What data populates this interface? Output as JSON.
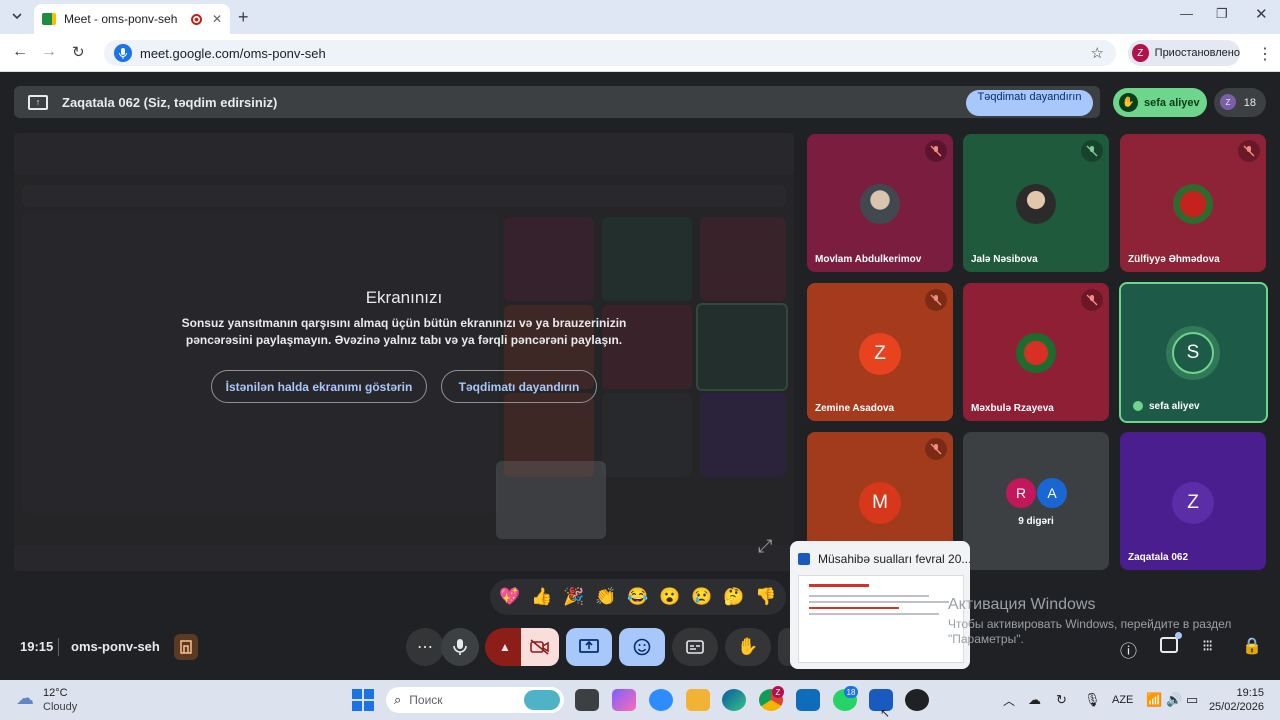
{
  "browser": {
    "tab_title": "Meet - oms-ponv-seh",
    "url": "meet.google.com/oms-ponv-seh",
    "profile_initial": "Z",
    "profile_status": "Приостановлено"
  },
  "presentation": {
    "banner": "Zaqatala 062 (Siz, təqdim edirsiniz)",
    "stop_button": "Təqdimatı dayandırın",
    "active_speaker": "sefa aliyev",
    "participant_count": "18"
  },
  "share_overlay": {
    "title": "Ekranınızı",
    "line1": "Sonsuz yansıtmanın qarşısını almaq üçün bütün ekranınızı və ya brauzerinizin",
    "line2": "pəncərəsini paylaşmayın. Əvəzinə yalnız tabı və ya fərqli pəncərəni paylaşın.",
    "show_anyway": "İstənilən halda ekranımı göstərin",
    "stop": "Təqdimatı dayandırın"
  },
  "tiles": [
    {
      "name": "Movlam Abdulkerimov",
      "muted": true,
      "bg": "#7a1d3f"
    },
    {
      "name": "Jalə Nəsibova",
      "muted": true,
      "bg": "#1f5a3d"
    },
    {
      "name": "Zülfiyyə Əhmədova",
      "muted": true,
      "bg": "#8e2236"
    },
    {
      "name": "Zemine Asadova",
      "initial": "Z",
      "muted": true,
      "bg": "#a63a1d"
    },
    {
      "name": "Məxbulə Rzayeva",
      "muted": true,
      "bg": "#8f1f35"
    },
    {
      "name": "sefa aliyev",
      "initial": "S",
      "muted": false,
      "bg": "#1e5a48"
    },
    {
      "name": "",
      "initial": "M",
      "muted": true,
      "bg": "#a23a1c"
    },
    {
      "name": "9 digəri",
      "initials": [
        "R",
        "A"
      ],
      "bg": "#3c4043"
    },
    {
      "name": "Zaqatala 062",
      "initial": "Z",
      "bg": "#4a1e8f"
    }
  ],
  "reactions": [
    "💖",
    "👍",
    "🎉",
    "👏",
    "😂",
    "😮",
    "😢",
    "🤔",
    "👎"
  ],
  "bottom": {
    "time": "19:15",
    "meeting_code": "oms-ponv-seh"
  },
  "thumbnail": {
    "title": "Müsahibə sualları fevral 20..."
  },
  "activation": {
    "title": "Активация Windows",
    "line1": "Чтобы активировать Windows, перейдите в раздел",
    "line2": "\"Параметры\"."
  },
  "taskbar": {
    "temp": "12°C",
    "weather": "Cloudy",
    "search_placeholder": "Поиск",
    "lang": "AZE",
    "clock_time": "19:15",
    "clock_date": "25/02/2026",
    "whatsapp_badge": "18",
    "chrome_badge": "Z"
  },
  "colors": {
    "accent_blue": "#a8c7fa",
    "speaker_green": "#6dd58c",
    "end_call_red": "#8c1d18"
  }
}
